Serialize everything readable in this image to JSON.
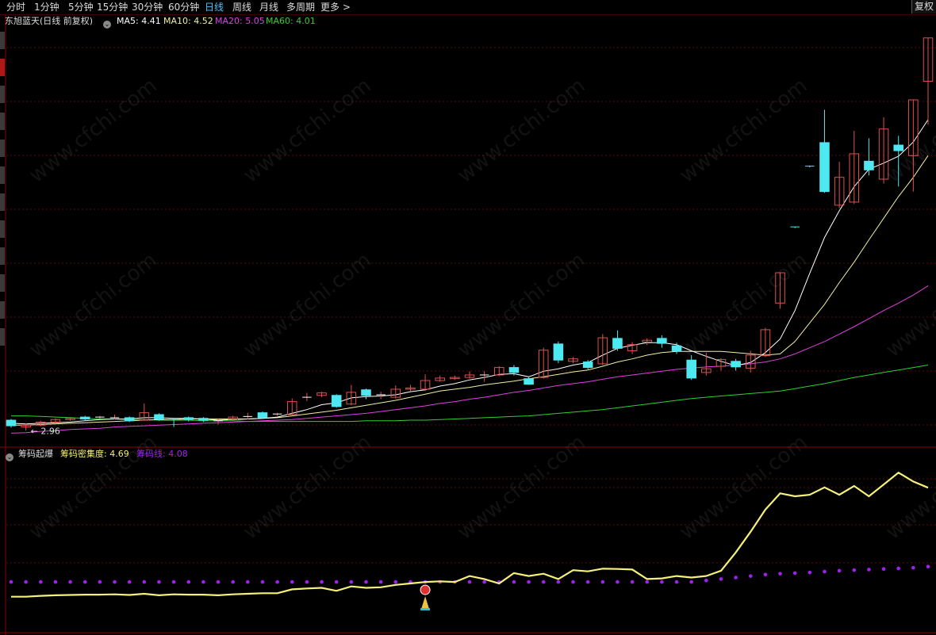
{
  "toolbar": {
    "tabs": [
      {
        "label": "分时",
        "active": false
      },
      {
        "label": "1分钟",
        "active": false
      },
      {
        "label": "5分钟",
        "active": false
      },
      {
        "label": "15分钟",
        "active": false
      },
      {
        "label": "30分钟",
        "active": false
      },
      {
        "label": "60分钟",
        "active": false
      },
      {
        "label": "日线",
        "active": true
      },
      {
        "label": "周线",
        "active": false
      },
      {
        "label": "月线",
        "active": false
      },
      {
        "label": "多周期",
        "active": false
      },
      {
        "label": "更多 >",
        "active": false
      }
    ],
    "right_button": "复权"
  },
  "main_header": {
    "stock": "东旭蓝天(日线 前复权)",
    "ma5": "MA5: 4.41",
    "ma10": "MA10: 4.52",
    "ma20": "MA20: 5.05",
    "ma60": "MA60: 4.01"
  },
  "sub_header": {
    "indicator": "筹码起爆",
    "density": "筹码密集度: 4.69",
    "chip_line": "筹码线: 4.08"
  },
  "watermark": "www.cfchi.com",
  "colors": {
    "up": "#e05050",
    "down": "#4ee8f0",
    "ma5": "#ffffff",
    "ma10": "#f0f0a0",
    "ma20": "#e040e0",
    "ma60": "#30d030",
    "density": "#f5f07a",
    "chip_line": "#a020f0",
    "grid": "#5a0a0a"
  },
  "chart_data": [
    {
      "type": "candlestick",
      "title": "东旭蓝天(日线 前复权)",
      "low_label": "2.96",
      "candles": [
        [
          3.13,
          3.04,
          3.15,
          3.01
        ],
        [
          3.02,
          3.05,
          3.08,
          2.96
        ],
        [
          3.05,
          3.1,
          3.12,
          3.03
        ],
        [
          3.1,
          3.14,
          3.16,
          3.08
        ],
        [
          3.14,
          3.16,
          3.18,
          3.12
        ],
        [
          3.18,
          3.15,
          3.2,
          3.13
        ],
        [
          3.17,
          3.18,
          3.2,
          3.15
        ],
        [
          3.17,
          3.17,
          3.22,
          3.14
        ],
        [
          3.17,
          3.12,
          3.19,
          3.1
        ],
        [
          3.13,
          3.25,
          3.4,
          3.12
        ],
        [
          3.22,
          3.15,
          3.24,
          3.12
        ],
        [
          3.14,
          3.13,
          3.17,
          3.02
        ],
        [
          3.17,
          3.14,
          3.19,
          3.11
        ],
        [
          3.16,
          3.13,
          3.18,
          3.1
        ],
        [
          3.12,
          3.12,
          3.15,
          3.06
        ],
        [
          3.14,
          3.18,
          3.2,
          3.12
        ],
        [
          3.19,
          3.19,
          3.25,
          3.14
        ],
        [
          3.25,
          3.17,
          3.27,
          3.15
        ],
        [
          3.23,
          3.23,
          3.25,
          3.2
        ],
        [
          3.22,
          3.43,
          3.48,
          3.2
        ],
        [
          3.49,
          3.5,
          3.57,
          3.44
        ],
        [
          3.53,
          3.57,
          3.59,
          3.5
        ],
        [
          3.53,
          3.35,
          3.55,
          3.33
        ],
        [
          3.39,
          3.58,
          3.7,
          3.37
        ],
        [
          3.62,
          3.53,
          3.64,
          3.47
        ],
        [
          3.54,
          3.54,
          3.59,
          3.47
        ],
        [
          3.5,
          3.63,
          3.69,
          3.48
        ],
        [
          3.63,
          3.65,
          3.7,
          3.6
        ],
        [
          3.63,
          3.77,
          3.87,
          3.6
        ],
        [
          3.77,
          3.81,
          3.85,
          3.75
        ],
        [
          3.8,
          3.82,
          3.85,
          3.78
        ],
        [
          3.82,
          3.86,
          3.92,
          3.8
        ],
        [
          3.86,
          3.86,
          3.92,
          3.75
        ],
        [
          3.86,
          3.98,
          4.0,
          3.84
        ],
        [
          3.98,
          3.9,
          4.02,
          3.85
        ],
        [
          3.8,
          3.71,
          3.84,
          3.7
        ],
        [
          3.82,
          4.26,
          4.3,
          3.8
        ],
        [
          4.36,
          4.1,
          4.4,
          4.05
        ],
        [
          4.08,
          4.12,
          4.15,
          4.05
        ],
        [
          4.07,
          3.98,
          4.1,
          3.95
        ],
        [
          4.04,
          4.46,
          4.52,
          4.02
        ],
        [
          4.45,
          4.29,
          4.58,
          4.25
        ],
        [
          4.25,
          4.35,
          4.39,
          4.2
        ],
        [
          4.39,
          4.42,
          4.45,
          4.34
        ],
        [
          4.45,
          4.37,
          4.5,
          4.3
        ],
        [
          4.33,
          4.25,
          4.38,
          4.2
        ],
        [
          4.1,
          3.81,
          4.18,
          3.78
        ],
        [
          3.9,
          3.96,
          4.22,
          3.85
        ],
        [
          4.0,
          4.11,
          4.13,
          3.93
        ],
        [
          4.08,
          3.99,
          4.12,
          3.93
        ],
        [
          3.97,
          4.18,
          4.25,
          3.9
        ],
        [
          4.17,
          4.59,
          4.62,
          4.15
        ],
        [
          5.02,
          5.51,
          5.51,
          4.93
        ],
        [
          6.25,
          6.24,
          6.25,
          6.23
        ],
        [
          7.23,
          7.22,
          7.24,
          7.21
        ],
        [
          7.61,
          6.82,
          8.14,
          6.8
        ],
        [
          6.6,
          7.05,
          7.3,
          6.55
        ],
        [
          6.65,
          7.43,
          7.8,
          6.62
        ],
        [
          7.31,
          7.17,
          7.68,
          7.08
        ],
        [
          7.02,
          7.83,
          8.02,
          6.95
        ],
        [
          7.57,
          7.48,
          7.72,
          6.9
        ],
        [
          7.4,
          8.3,
          8.3,
          6.82
        ],
        [
          8.6,
          9.3,
          9.3,
          7.9
        ]
      ],
      "ma": {
        "ma5": [
          3.08,
          3.07,
          3.08,
          3.09,
          3.1,
          3.12,
          3.14,
          3.15,
          3.15,
          3.17,
          3.17,
          3.16,
          3.16,
          3.15,
          3.13,
          3.14,
          3.15,
          3.16,
          3.18,
          3.24,
          3.3,
          3.38,
          3.41,
          3.49,
          3.51,
          3.52,
          3.54,
          3.59,
          3.62,
          3.68,
          3.72,
          3.78,
          3.82,
          3.87,
          3.88,
          3.83,
          3.92,
          3.96,
          4.02,
          4.06,
          4.18,
          4.29,
          4.34,
          4.38,
          4.38,
          4.35,
          4.25,
          4.16,
          4.08,
          4.01,
          4.06,
          4.22,
          4.44,
          4.9,
          5.5,
          6.08,
          6.51,
          6.9,
          7.18,
          7.28,
          7.39,
          7.62,
          7.98
        ],
        "ma10": [
          3.05,
          3.05,
          3.06,
          3.07,
          3.08,
          3.09,
          3.1,
          3.11,
          3.12,
          3.13,
          3.14,
          3.14,
          3.15,
          3.15,
          3.15,
          3.15,
          3.15,
          3.16,
          3.17,
          3.2,
          3.23,
          3.26,
          3.29,
          3.33,
          3.37,
          3.41,
          3.45,
          3.5,
          3.55,
          3.6,
          3.63,
          3.66,
          3.7,
          3.73,
          3.76,
          3.8,
          3.83,
          3.87,
          3.91,
          3.94,
          4.0,
          4.07,
          4.12,
          4.18,
          4.22,
          4.24,
          4.24,
          4.24,
          4.24,
          4.22,
          4.2,
          4.18,
          4.2,
          4.4,
          4.7,
          5.0,
          5.35,
          5.68,
          6.04,
          6.39,
          6.74,
          7.05,
          7.4
        ],
        "ma20": [
          2.92,
          2.93,
          2.95,
          2.96,
          2.98,
          2.99,
          3.0,
          3.02,
          3.03,
          3.04,
          3.05,
          3.06,
          3.07,
          3.08,
          3.09,
          3.1,
          3.11,
          3.12,
          3.13,
          3.14,
          3.16,
          3.18,
          3.2,
          3.22,
          3.24,
          3.27,
          3.3,
          3.33,
          3.36,
          3.4,
          3.43,
          3.47,
          3.5,
          3.54,
          3.58,
          3.61,
          3.65,
          3.69,
          3.72,
          3.75,
          3.79,
          3.83,
          3.86,
          3.89,
          3.92,
          3.95,
          3.97,
          3.99,
          4.0,
          4.02,
          4.04,
          4.07,
          4.12,
          4.2,
          4.3,
          4.4,
          4.52,
          4.64,
          4.77,
          4.9,
          5.02,
          5.15,
          5.3
        ],
        "ma60": [
          3.2,
          3.2,
          3.19,
          3.18,
          3.17,
          3.16,
          3.15,
          3.15,
          3.14,
          3.14,
          3.13,
          3.13,
          3.13,
          3.12,
          3.12,
          3.12,
          3.11,
          3.11,
          3.11,
          3.11,
          3.11,
          3.11,
          3.11,
          3.11,
          3.12,
          3.12,
          3.12,
          3.13,
          3.13,
          3.14,
          3.15,
          3.16,
          3.17,
          3.18,
          3.19,
          3.2,
          3.22,
          3.24,
          3.26,
          3.28,
          3.3,
          3.33,
          3.36,
          3.39,
          3.42,
          3.45,
          3.48,
          3.5,
          3.52,
          3.54,
          3.56,
          3.58,
          3.6,
          3.64,
          3.68,
          3.72,
          3.77,
          3.82,
          3.86,
          3.9,
          3.94,
          3.98,
          4.02
        ]
      },
      "ylim": [
        2.9,
        9.4
      ]
    },
    {
      "type": "line",
      "title": "筹码起爆",
      "series": [
        {
          "name": "筹码密集度",
          "values": [
            1.0,
            1.0,
            1.03,
            1.05,
            1.06,
            1.07,
            1.07,
            1.08,
            1.06,
            1.1,
            1.05,
            1.08,
            1.07,
            1.07,
            1.05,
            1.08,
            1.1,
            1.12,
            1.12,
            1.25,
            1.28,
            1.3,
            1.2,
            1.35,
            1.3,
            1.32,
            1.4,
            1.45,
            1.5,
            1.52,
            1.5,
            1.7,
            1.6,
            1.45,
            1.8,
            1.7,
            1.78,
            1.6,
            1.9,
            1.86,
            1.95,
            1.94,
            1.92,
            1.6,
            1.62,
            1.7,
            1.65,
            1.7,
            1.88,
            2.5,
            3.2,
            3.95,
            4.5,
            4.4,
            4.45,
            4.7,
            4.45,
            4.75,
            4.4,
            4.8,
            5.2,
            4.9,
            4.69
          ]
        },
        {
          "name": "筹码线",
          "values": [
            1.5,
            1.5,
            1.5,
            1.5,
            1.5,
            1.5,
            1.5,
            1.5,
            1.5,
            1.5,
            1.5,
            1.5,
            1.5,
            1.5,
            1.5,
            1.5,
            1.5,
            1.5,
            1.5,
            1.5,
            1.5,
            1.5,
            1.5,
            1.5,
            1.5,
            1.5,
            1.5,
            1.5,
            1.5,
            1.5,
            1.5,
            1.5,
            1.5,
            1.5,
            1.5,
            1.5,
            1.5,
            1.5,
            1.5,
            1.5,
            1.5,
            1.5,
            1.5,
            1.5,
            1.5,
            1.5,
            1.5,
            1.55,
            1.6,
            1.65,
            1.7,
            1.75,
            1.78,
            1.8,
            1.82,
            1.85,
            1.88,
            1.9,
            1.92,
            1.94,
            1.96,
            1.98,
            2.02
          ]
        }
      ],
      "signal_index": 28,
      "ylim": [
        0,
        5.5
      ]
    }
  ]
}
